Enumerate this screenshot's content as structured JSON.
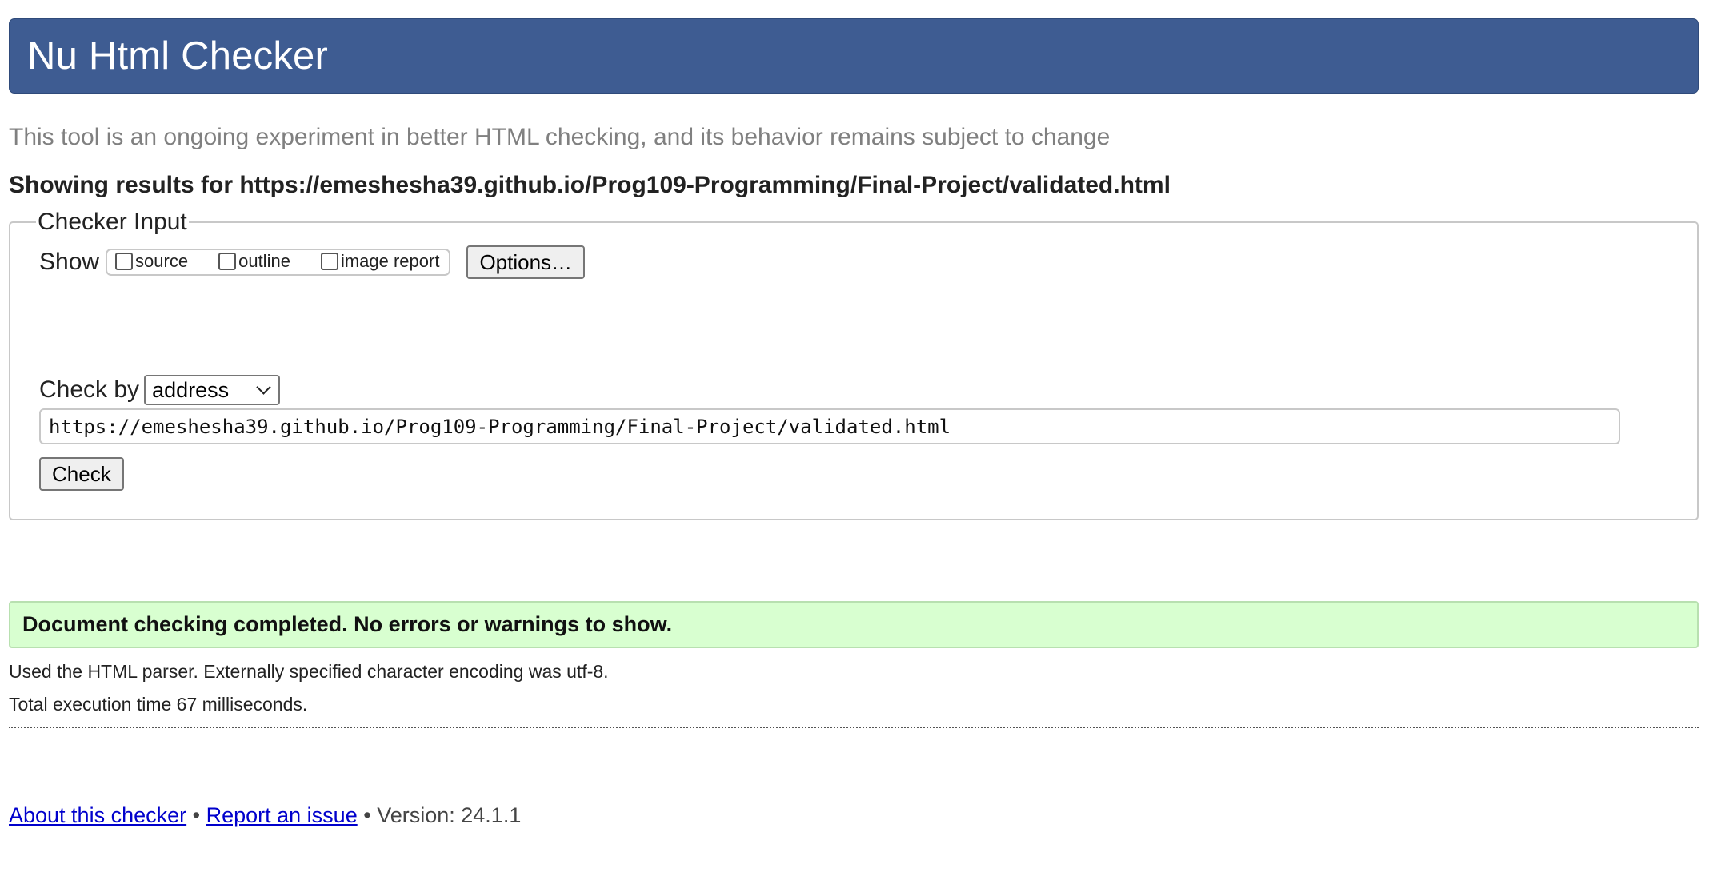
{
  "header": {
    "title": "Nu Html Checker"
  },
  "subtitle": "This tool is an ongoing experiment in better HTML checking, and its behavior remains subject to change",
  "results": {
    "prefix": "Showing results for ",
    "url": "https://emeshesha39.github.io/Prog109-Programming/Final-Project/validated.html"
  },
  "checker_input": {
    "legend": "Checker Input",
    "show_label": "Show",
    "show_options": [
      {
        "label": "source",
        "checked": false
      },
      {
        "label": "outline",
        "checked": false
      },
      {
        "label": "image report",
        "checked": false
      }
    ],
    "options_button": "Options…",
    "check_by_label": "Check by",
    "check_by_value": "address",
    "address_value": "https://emeshesha39.github.io/Prog109-Programming/Final-Project/validated.html",
    "check_button": "Check"
  },
  "status": {
    "message": "Document checking completed. No errors or warnings to show.",
    "background": "#d8ffd0"
  },
  "details": {
    "parser": "Used the HTML parser. Externally specified character encoding was utf-8.",
    "execution": "Total execution time 67 milliseconds."
  },
  "footer": {
    "about_link": "About this checker",
    "separator": "•",
    "report_link": "Report an issue",
    "version": "Version: 24.1.1"
  },
  "colors": {
    "header_bg": "#3e5c92",
    "link": "#0000cc"
  }
}
